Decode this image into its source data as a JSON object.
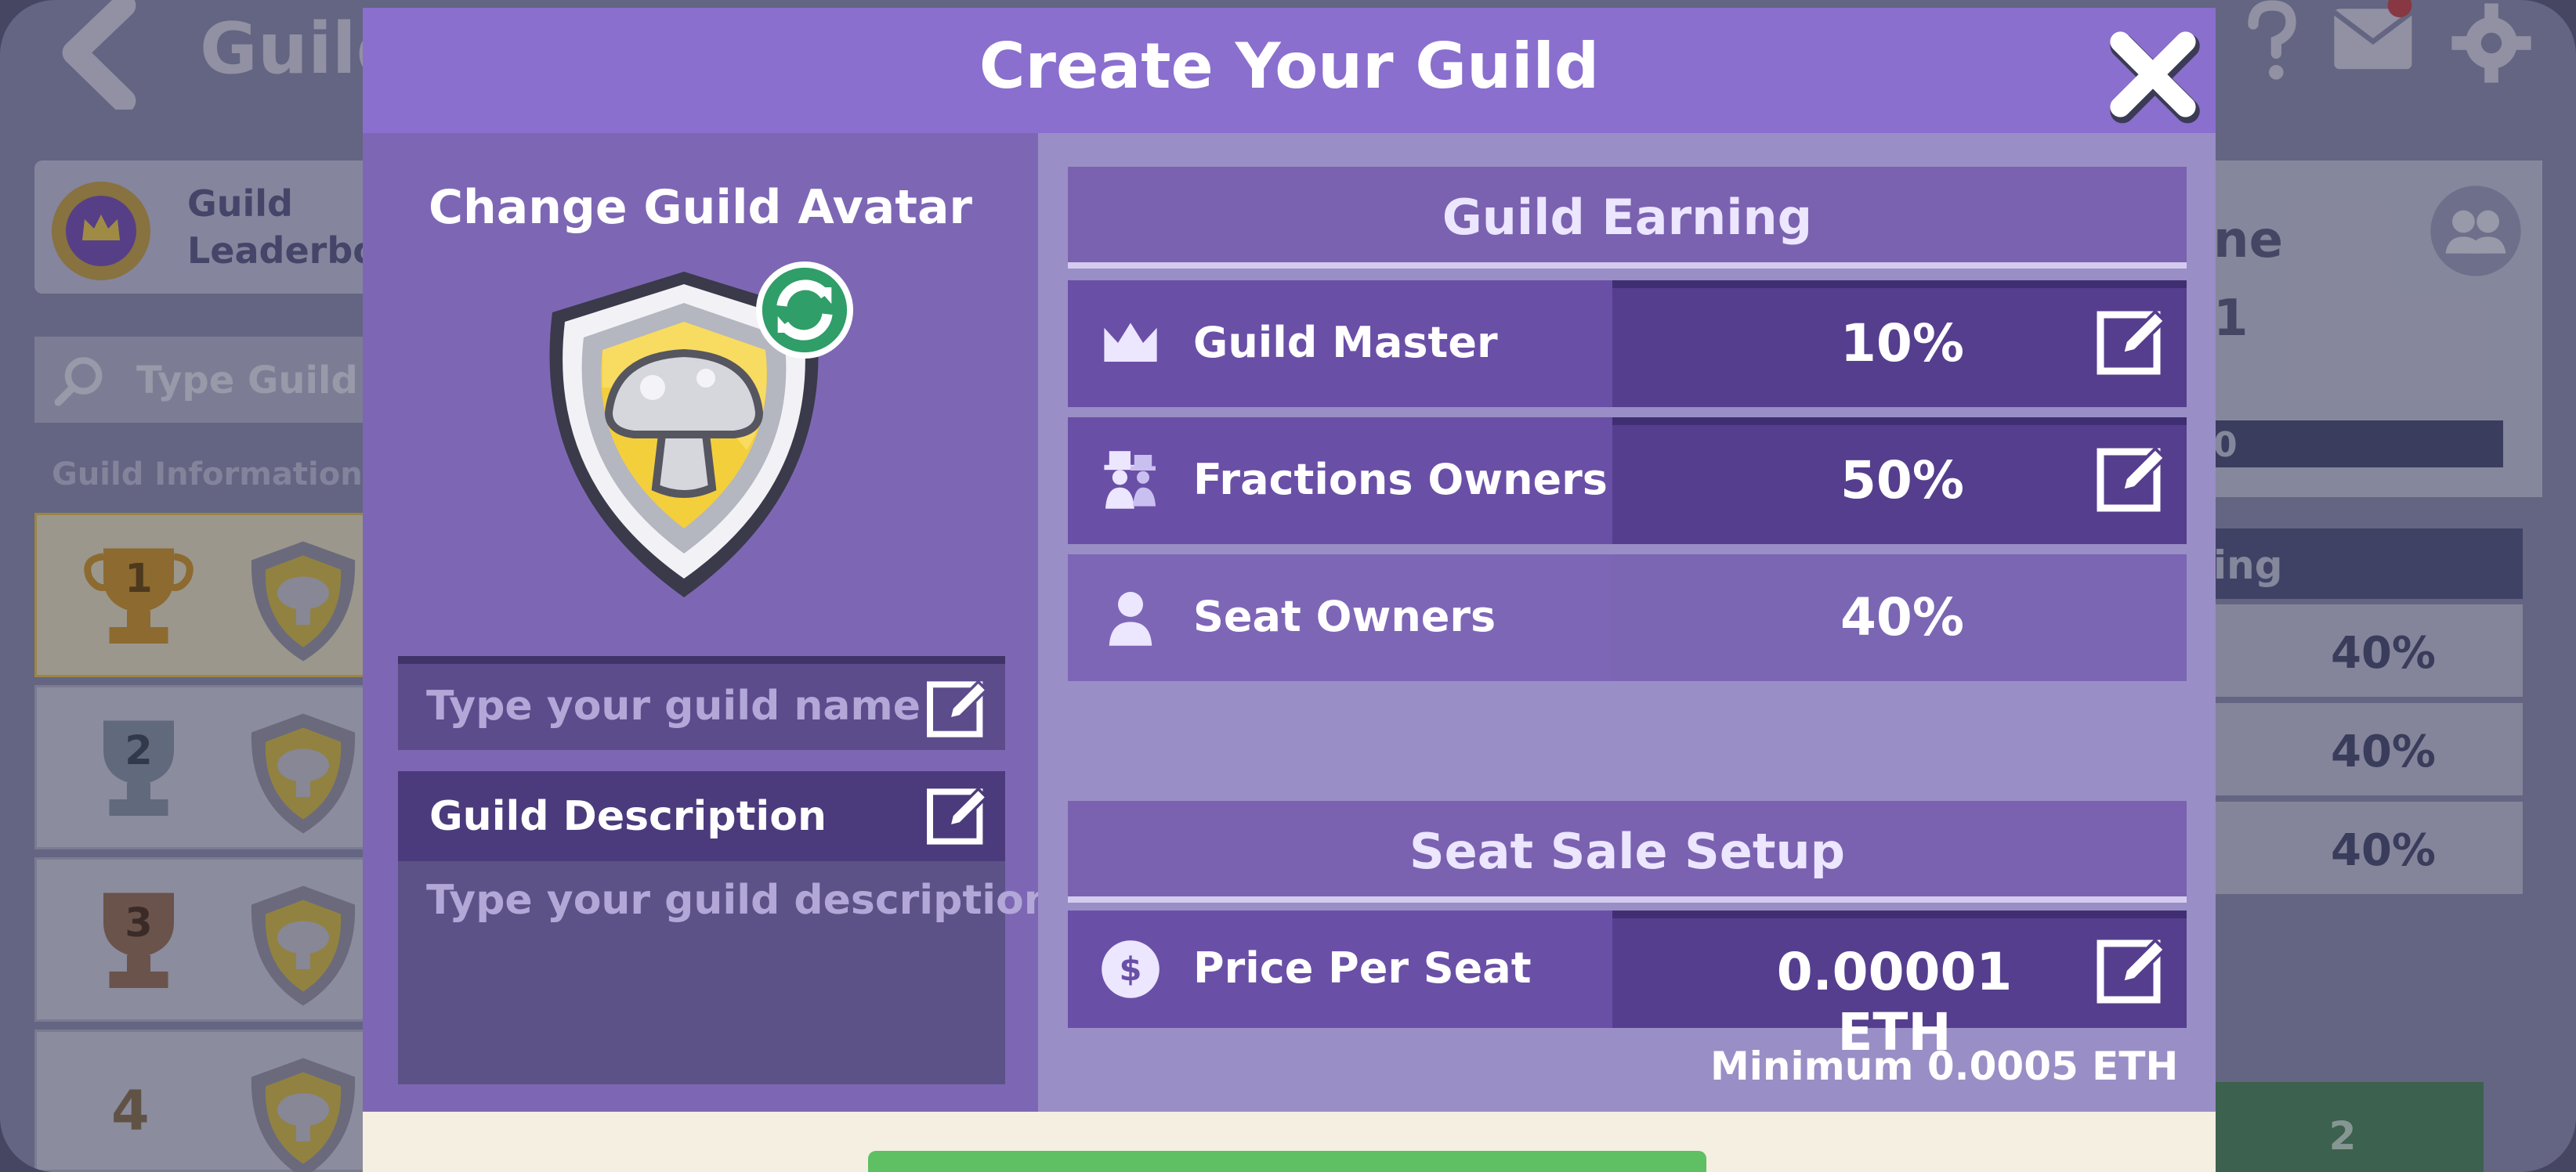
{
  "background": {
    "header_title": "Guild",
    "leaderboard_label_line1": "Guild",
    "leaderboard_label_line2": "Leaderboa",
    "search_placeholder": "Type Guild Na",
    "info_label": "Guild Information",
    "rank_4": "4",
    "right_text_1": "ne",
    "right_text_2": "1",
    "right_bar_text": "0",
    "right_section_label": "ing",
    "right_percent_1": "40%",
    "right_percent_2": "40%",
    "right_percent_3": "40%",
    "right_button_text": "2"
  },
  "modal": {
    "title": "Create Your Guild",
    "avatar_label": "Change Guild Avatar",
    "name_placeholder": "Type your guild name",
    "description_label": "Guild Description",
    "description_placeholder": "Type your guild description"
  },
  "earning": {
    "title": "Guild Earning",
    "rows": [
      {
        "label": "Guild Master",
        "value": "10%",
        "icon": "crown-icon"
      },
      {
        "label": "Fractions Owners",
        "value": "50%",
        "icon": "fraction-owners-icon"
      },
      {
        "label": "Seat Owners",
        "value": "40%",
        "icon": "person-icon"
      }
    ]
  },
  "seat_sale": {
    "title": "Seat Sale Setup",
    "price_label": "Price Per Seat",
    "price_value": "0.00001 ETH",
    "minimum_note": "Minimum 0.0005 ETH"
  },
  "colors": {
    "header": "#8a6fce",
    "row_left": "#6a4fa7",
    "row_right": "#553e8e",
    "accent_green": "#5fbf63"
  }
}
